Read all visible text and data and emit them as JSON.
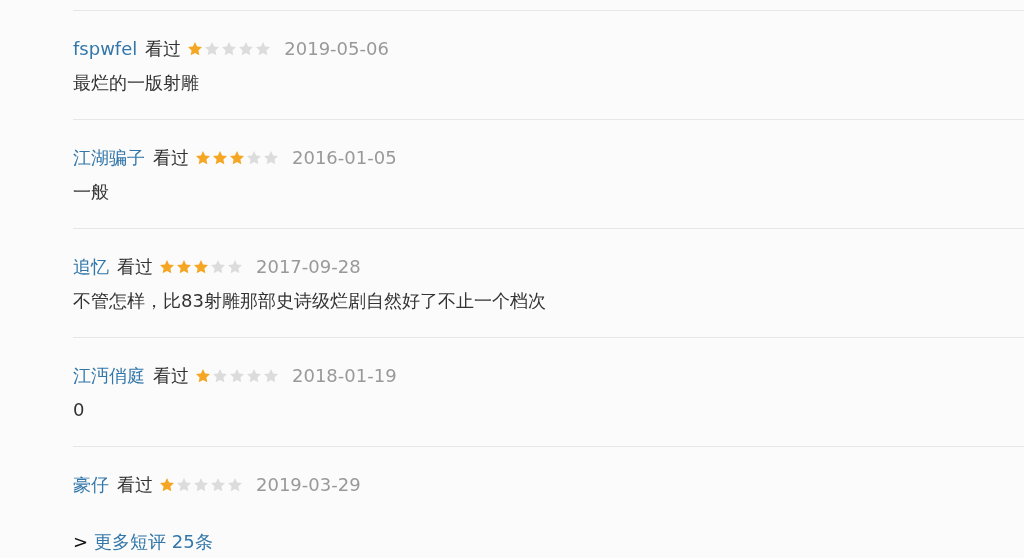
{
  "reviews": [
    {
      "user": "fspwfel",
      "status": "看过",
      "stars": 1,
      "date": "2019-05-06",
      "comment": "最烂的一版射雕"
    },
    {
      "user": "江湖骗子",
      "status": "看过",
      "stars": 3,
      "date": "2016-01-05",
      "comment": "一般"
    },
    {
      "user": "追忆",
      "status": "看过",
      "stars": 3,
      "date": "2017-09-28",
      "comment": "不管怎样，比83射雕那部史诗级烂剧自然好了不止一个档次"
    },
    {
      "user": "江沔俏庭",
      "status": "看过",
      "stars": 1,
      "date": "2018-01-19",
      "comment": "0"
    },
    {
      "user": "豪仔",
      "status": "看过",
      "stars": 1,
      "date": "2019-03-29"
    }
  ],
  "more": {
    "prefix": ">",
    "label": "更多短评 25条"
  }
}
